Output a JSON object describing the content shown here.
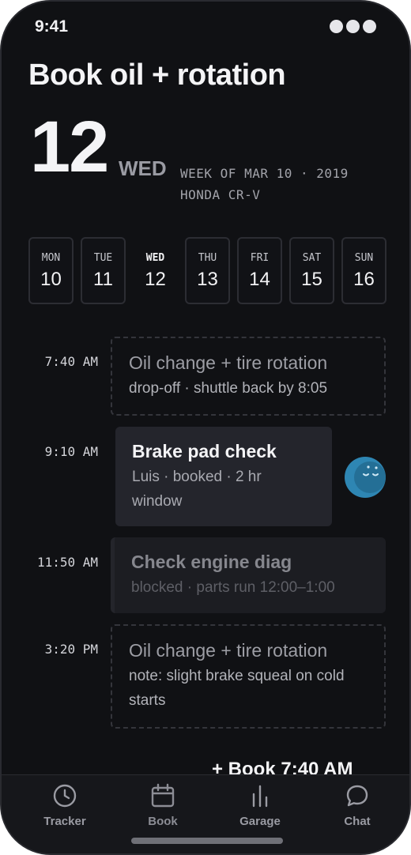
{
  "status": {
    "time": "9:41"
  },
  "header": {
    "title": "Book oil + rotation",
    "day_number": "12",
    "day_of_week": "WED",
    "week_line": "WEEK OF MAR 10 · 2019",
    "vehicle": "HONDA CR-V"
  },
  "days": [
    {
      "dow": "MON",
      "num": "10"
    },
    {
      "dow": "TUE",
      "num": "11"
    },
    {
      "dow": "WED",
      "num": "12",
      "selected": true
    },
    {
      "dow": "THU",
      "num": "13"
    },
    {
      "dow": "FRI",
      "num": "14"
    },
    {
      "dow": "SAT",
      "num": "15"
    },
    {
      "dow": "SUN",
      "num": "16"
    }
  ],
  "slots": [
    {
      "time": "7:40 AM",
      "state": "open",
      "title": "Oil change + tire rotation",
      "sub": "drop-off · shuttle back by 8:05"
    },
    {
      "time": "9:10 AM",
      "state": "booked",
      "title": "Brake pad check",
      "sub": "Luis · booked · 2 hr window"
    },
    {
      "time": "11:50 AM",
      "state": "blocked",
      "title": "Check engine diag",
      "sub": "blocked · parts run 12:00–1:00"
    },
    {
      "time": "3:20 PM",
      "state": "open",
      "title": "Oil change + tire rotation",
      "sub": "note: slight brake squeal on cold starts"
    }
  ],
  "cta": {
    "label": "+ Book 7:40 AM"
  },
  "tabs": [
    {
      "label": "Tracker",
      "icon": "clock-icon"
    },
    {
      "label": "Book",
      "icon": "calendar-icon",
      "active": true
    },
    {
      "label": "Garage",
      "icon": "bar-chart-icon"
    },
    {
      "label": "Chat",
      "icon": "chat-bubble-icon"
    }
  ],
  "colors": {
    "background": "#101114",
    "card_booked": "#24252c",
    "avatar": "#2e86b3"
  }
}
